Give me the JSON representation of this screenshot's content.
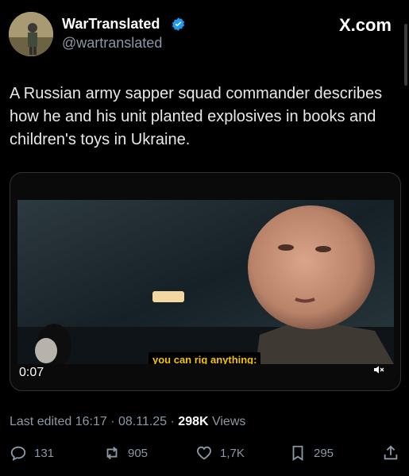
{
  "author": {
    "name": "WarTranslated",
    "handle": "@wartranslated",
    "verified_color": "#1d9bf0"
  },
  "site": "X.com",
  "tweet": {
    "text": "A Russian army sapper squad commander describes how he and his unit planted explosives in books and children's toys in Ukraine."
  },
  "video": {
    "caption": "you can rig anything:",
    "time": "0:07",
    "mute_icon": "speaker-muted-icon"
  },
  "meta": {
    "edited": "Last edited 16:17 · 08.11.25 · ",
    "views_count": "298K",
    "views_label": " Views"
  },
  "actions": {
    "replies": "131",
    "reposts": "905",
    "likes": "1,7K",
    "bookmarks": "295"
  },
  "colors": {
    "background": "#000000",
    "text": "#e7e9ea",
    "secondary": "#8b98a5",
    "caption_text": "#f5c400"
  }
}
